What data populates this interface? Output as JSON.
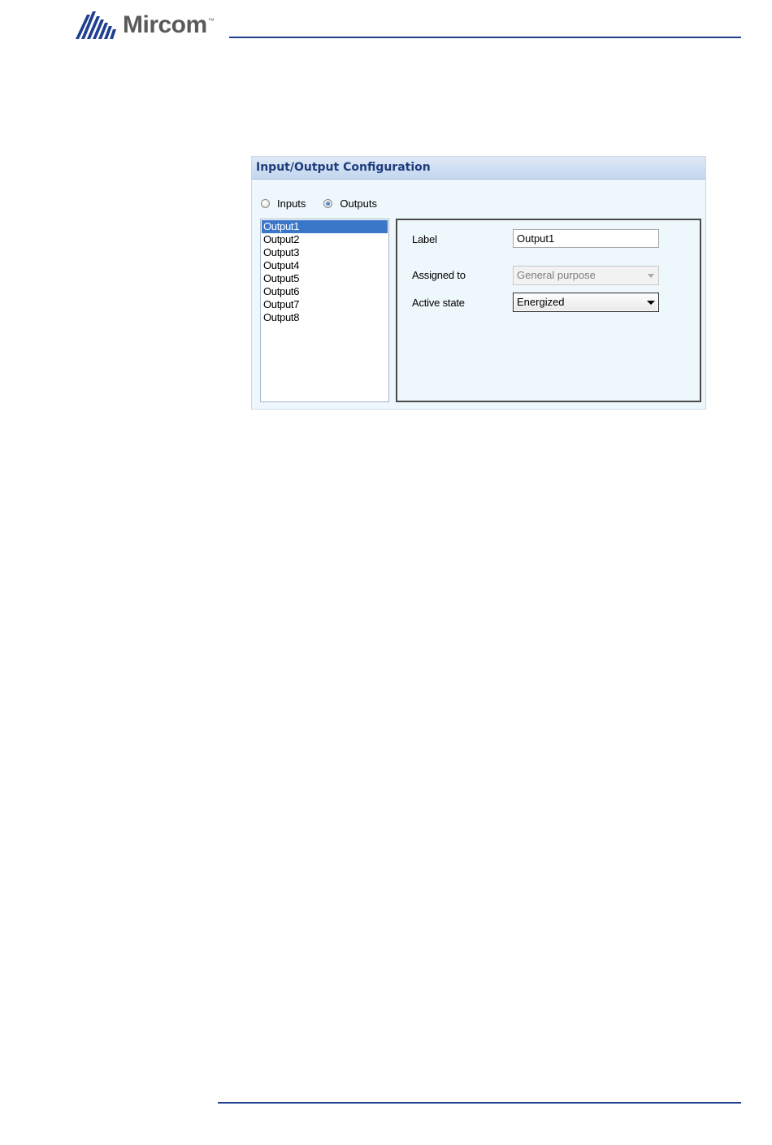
{
  "brand": {
    "name": "Mircom",
    "trademark": "™",
    "color": "#1f3f8f"
  },
  "panel": {
    "title": "Input/Output Configuration",
    "radios": [
      {
        "label": "Inputs",
        "checked": false
      },
      {
        "label": "Outputs",
        "checked": true
      }
    ],
    "outputs": [
      "Output1",
      "Output2",
      "Output3",
      "Output4",
      "Output5",
      "Output6",
      "Output7",
      "Output8"
    ],
    "selected_index": 0,
    "fields": {
      "label": {
        "caption": "Label",
        "value": "Output1"
      },
      "assigned_to": {
        "caption": "Assigned to",
        "value": "General purpose",
        "disabled": true
      },
      "active_state": {
        "caption": "Active state",
        "value": "Energized"
      }
    }
  }
}
